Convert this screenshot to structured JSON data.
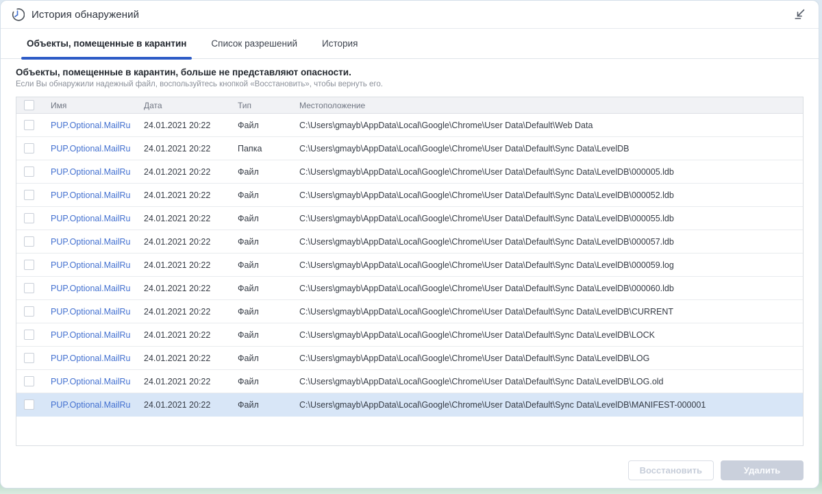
{
  "window": {
    "title": "История обнаружений"
  },
  "tabs": [
    {
      "label": "Объекты, помещенные в карантин",
      "active": true
    },
    {
      "label": "Список разрешений",
      "active": false
    },
    {
      "label": "История",
      "active": false
    }
  ],
  "intro": {
    "headline": "Объекты, помещенные в карантин, больше не представляют опасности.",
    "note": "Если Вы обнаружили надежный файл, воспользуйтесь кнопкой «Восстановить», чтобы вернуть его."
  },
  "table": {
    "columns": [
      "Имя",
      "Дата",
      "Тип",
      "Местоположение"
    ],
    "rows": [
      {
        "name": "PUP.Optional.MailRu",
        "date": "24.01.2021 20:22",
        "type": "Файл",
        "location": "C:\\Users\\gmayb\\AppData\\Local\\Google\\Chrome\\User Data\\Default\\Web Data",
        "selected": false
      },
      {
        "name": "PUP.Optional.MailRu",
        "date": "24.01.2021 20:22",
        "type": "Папка",
        "location": "C:\\Users\\gmayb\\AppData\\Local\\Google\\Chrome\\User Data\\Default\\Sync Data\\LevelDB",
        "selected": false
      },
      {
        "name": "PUP.Optional.MailRu",
        "date": "24.01.2021 20:22",
        "type": "Файл",
        "location": "C:\\Users\\gmayb\\AppData\\Local\\Google\\Chrome\\User Data\\Default\\Sync Data\\LevelDB\\000005.ldb",
        "selected": false
      },
      {
        "name": "PUP.Optional.MailRu",
        "date": "24.01.2021 20:22",
        "type": "Файл",
        "location": "C:\\Users\\gmayb\\AppData\\Local\\Google\\Chrome\\User Data\\Default\\Sync Data\\LevelDB\\000052.ldb",
        "selected": false
      },
      {
        "name": "PUP.Optional.MailRu",
        "date": "24.01.2021 20:22",
        "type": "Файл",
        "location": "C:\\Users\\gmayb\\AppData\\Local\\Google\\Chrome\\User Data\\Default\\Sync Data\\LevelDB\\000055.ldb",
        "selected": false
      },
      {
        "name": "PUP.Optional.MailRu",
        "date": "24.01.2021 20:22",
        "type": "Файл",
        "location": "C:\\Users\\gmayb\\AppData\\Local\\Google\\Chrome\\User Data\\Default\\Sync Data\\LevelDB\\000057.ldb",
        "selected": false
      },
      {
        "name": "PUP.Optional.MailRu",
        "date": "24.01.2021 20:22",
        "type": "Файл",
        "location": "C:\\Users\\gmayb\\AppData\\Local\\Google\\Chrome\\User Data\\Default\\Sync Data\\LevelDB\\000059.log",
        "selected": false
      },
      {
        "name": "PUP.Optional.MailRu",
        "date": "24.01.2021 20:22",
        "type": "Файл",
        "location": "C:\\Users\\gmayb\\AppData\\Local\\Google\\Chrome\\User Data\\Default\\Sync Data\\LevelDB\\000060.ldb",
        "selected": false
      },
      {
        "name": "PUP.Optional.MailRu",
        "date": "24.01.2021 20:22",
        "type": "Файл",
        "location": "C:\\Users\\gmayb\\AppData\\Local\\Google\\Chrome\\User Data\\Default\\Sync Data\\LevelDB\\CURRENT",
        "selected": false
      },
      {
        "name": "PUP.Optional.MailRu",
        "date": "24.01.2021 20:22",
        "type": "Файл",
        "location": "C:\\Users\\gmayb\\AppData\\Local\\Google\\Chrome\\User Data\\Default\\Sync Data\\LevelDB\\LOCK",
        "selected": false
      },
      {
        "name": "PUP.Optional.MailRu",
        "date": "24.01.2021 20:22",
        "type": "Файл",
        "location": "C:\\Users\\gmayb\\AppData\\Local\\Google\\Chrome\\User Data\\Default\\Sync Data\\LevelDB\\LOG",
        "selected": false
      },
      {
        "name": "PUP.Optional.MailRu",
        "date": "24.01.2021 20:22",
        "type": "Файл",
        "location": "C:\\Users\\gmayb\\AppData\\Local\\Google\\Chrome\\User Data\\Default\\Sync Data\\LevelDB\\LOG.old",
        "selected": false
      },
      {
        "name": "PUP.Optional.MailRu",
        "date": "24.01.2021 20:22",
        "type": "Файл",
        "location": "C:\\Users\\gmayb\\AppData\\Local\\Google\\Chrome\\User Data\\Default\\Sync Data\\LevelDB\\MANIFEST-000001",
        "selected": true
      }
    ]
  },
  "buttons": {
    "restore": "Восстановить",
    "delete": "Удалить"
  },
  "icons": {
    "title": "history-clock-icon",
    "header_action": "collapse-arrow-icon"
  },
  "colors": {
    "accent_blue": "#2d5bc6",
    "link_blue": "#4270d0",
    "selected_row_bg": "#d8e6f7",
    "disabled_button_bg": "#cad0dc",
    "header_bg": "#f1f2f5",
    "backdrop_green": "#b7d6c5"
  }
}
